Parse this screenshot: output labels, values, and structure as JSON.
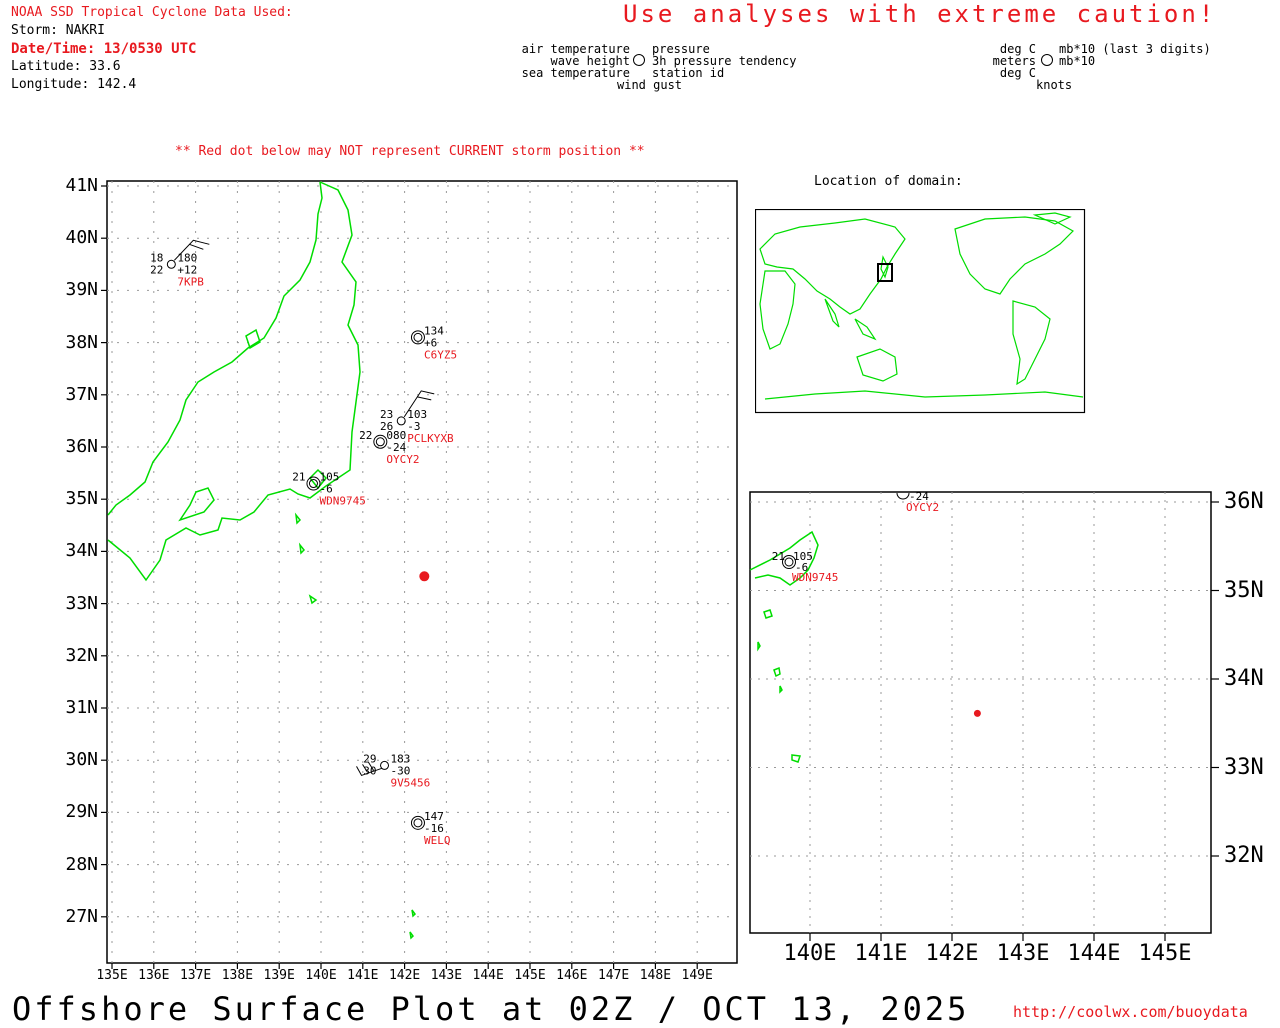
{
  "header": {
    "source": "NOAA SSD Tropical Cyclone Data Used:",
    "storm": "Storm: NAKRI",
    "datetime": "Date/Time: 13/0530 UTC",
    "latitude": "Latitude: 33.6",
    "longitude": "Longitude: 142.4",
    "caution": "Use analyses with extreme caution!"
  },
  "legend": {
    "left_items": [
      "air temperature",
      "wave height",
      "sea temperature"
    ],
    "right_items": [
      "pressure",
      "3h pressure tendency",
      "station id"
    ],
    "bottom_item": "wind gust",
    "units_left": [
      "deg C",
      "meters",
      "deg C"
    ],
    "units_right": [
      "mb*10 (last 3 digits)",
      "mb*10"
    ],
    "units_bottom": "knots"
  },
  "notice": "** Red dot below may NOT represent CURRENT storm position **",
  "domain_label": "Location of domain:",
  "footer": {
    "title": "Offshore Surface Plot at 02Z / OCT 13, 2025",
    "url": "http://coolwx.com/buoydata"
  },
  "colors": {
    "land": "#00dd00",
    "alert": "#e8191f",
    "grid": "#888888"
  },
  "main_map": {
    "lat_ticks": [
      "41N",
      "40N",
      "39N",
      "38N",
      "37N",
      "36N",
      "35N",
      "34N",
      "33N",
      "32N",
      "31N",
      "30N",
      "29N",
      "28N",
      "27N"
    ],
    "lon_ticks": [
      "135E",
      "136E",
      "137E",
      "138E",
      "139E",
      "140E",
      "141E",
      "142E",
      "143E",
      "144E",
      "145E",
      "146E",
      "147E",
      "148E",
      "149E"
    ],
    "storm_position": {
      "lat": 33.6,
      "lon": 142.4
    },
    "stations": [
      {
        "id": "7KPB",
        "air": "18",
        "pressure": "180",
        "sea": "22",
        "tendency": "+12",
        "lat": 39.5,
        "lon": 136.3
      },
      {
        "id": "C6YZ5",
        "pressure": "134",
        "tendency": "+6",
        "lat": 38.1,
        "lon": 142.2
      },
      {
        "id": "PCLKYXB",
        "air": "23",
        "pressure": "103",
        "wave": "26",
        "tendency": "-3",
        "lat": 36.5,
        "lon": 141.8
      },
      {
        "id": "OYCY2",
        "air": "22",
        "pressure": "080",
        "tendency": "-24",
        "lat": 36.1,
        "lon": 141.3
      },
      {
        "id": "WDN9745",
        "air": "21",
        "pressure": "105",
        "tendency": "-6",
        "lat": 35.3,
        "lon": 139.7
      },
      {
        "id": "9V5456",
        "air": "29",
        "pressure": "183",
        "sea": "30",
        "tendency": "-30",
        "lat": 29.9,
        "lon": 141.4
      },
      {
        "id": "WELQ",
        "pressure": "147",
        "tendency": "-16",
        "lat": 28.8,
        "lon": 142.2
      }
    ]
  },
  "zoom_map": {
    "lat_ticks": [
      "36N",
      "35N",
      "34N",
      "33N",
      "32N"
    ],
    "lon_ticks": [
      "140E",
      "141E",
      "142E",
      "143E",
      "144E",
      "145E"
    ]
  }
}
